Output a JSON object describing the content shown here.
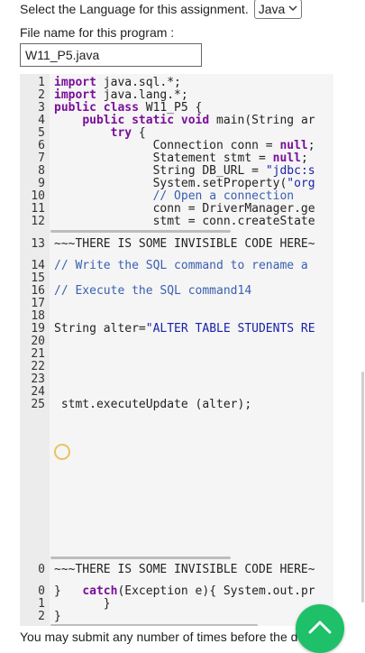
{
  "header": {
    "language_prompt": "Select the Language for this assignment.",
    "language_value": "Java"
  },
  "file": {
    "label": "File name for this program :",
    "value": "W11_P5.java"
  },
  "code_lines": [
    {
      "n": "1",
      "segs": [
        {
          "t": "import",
          "c": "kw"
        },
        {
          "t": " java.sql.*;",
          "c": ""
        }
      ]
    },
    {
      "n": "2",
      "segs": [
        {
          "t": "import",
          "c": "kw"
        },
        {
          "t": " java.lang.*;",
          "c": ""
        }
      ]
    },
    {
      "n": "3",
      "segs": [
        {
          "t": "public class",
          "c": "kw"
        },
        {
          "t": " W11_P5 {",
          "c": ""
        }
      ]
    },
    {
      "n": "4",
      "segs": [
        {
          "t": "    ",
          "c": ""
        },
        {
          "t": "public static void",
          "c": "kw"
        },
        {
          "t": " main(String ar",
          "c": ""
        }
      ]
    },
    {
      "n": "5",
      "segs": [
        {
          "t": "        ",
          "c": ""
        },
        {
          "t": "try",
          "c": "kw"
        },
        {
          "t": " {",
          "c": ""
        }
      ]
    },
    {
      "n": "6",
      "segs": [
        {
          "t": "              Connection conn = ",
          "c": ""
        },
        {
          "t": "null",
          "c": "kw"
        },
        {
          "t": ";",
          "c": ""
        }
      ]
    },
    {
      "n": "7",
      "segs": [
        {
          "t": "              Statement stmt = ",
          "c": ""
        },
        {
          "t": "null",
          "c": "kw"
        },
        {
          "t": ";",
          "c": ""
        }
      ]
    },
    {
      "n": "8",
      "segs": [
        {
          "t": "              String DB_URL = ",
          "c": ""
        },
        {
          "t": "\"jdbc:s",
          "c": "str"
        }
      ]
    },
    {
      "n": "9",
      "segs": [
        {
          "t": "              System.setProperty(",
          "c": ""
        },
        {
          "t": "\"org",
          "c": "str"
        }
      ]
    },
    {
      "n": "10",
      "segs": [
        {
          "t": "              ",
          "c": ""
        },
        {
          "t": "// Open a connection",
          "c": "com"
        }
      ]
    },
    {
      "n": "11",
      "segs": [
        {
          "t": "              conn = DriverManager.ge",
          "c": ""
        }
      ]
    },
    {
      "n": "12",
      "segs": [
        {
          "t": "              stmt = conn.createState",
          "c": ""
        }
      ]
    },
    {
      "n": "13",
      "segs": [
        {
          "t": "~~~THERE IS SOME INVISIBLE CODE HERE~",
          "c": ""
        }
      ]
    },
    {
      "n": "14",
      "segs": [
        {
          "t": "// Write the SQL command to rename a",
          "c": "com"
        }
      ]
    },
    {
      "n": "15",
      "segs": []
    },
    {
      "n": "16",
      "segs": [
        {
          "t": "// Execute the SQL command14",
          "c": "com"
        }
      ]
    },
    {
      "n": "17",
      "segs": []
    },
    {
      "n": "18",
      "segs": []
    },
    {
      "n": "19",
      "segs": [
        {
          "t": "String alter=",
          "c": ""
        },
        {
          "t": "\"ALTER TABLE STUDENTS RE",
          "c": "str"
        }
      ]
    },
    {
      "n": "20",
      "segs": []
    },
    {
      "n": "21",
      "segs": []
    },
    {
      "n": "22",
      "segs": []
    },
    {
      "n": "23",
      "segs": []
    },
    {
      "n": "24",
      "segs": []
    },
    {
      "n": "25",
      "segs": [
        {
          "t": " stmt.executeUpdate (alter);",
          "c": ""
        }
      ]
    },
    {
      "n": "0",
      "segs": [
        {
          "t": "~~~THERE IS SOME INVISIBLE CODE HERE~",
          "c": ""
        }
      ]
    },
    {
      "n": "0",
      "segs": [
        {
          "t": "}   ",
          "c": ""
        },
        {
          "t": "catch",
          "c": "kw"
        },
        {
          "t": "(Exception e){ System.out.pr",
          "c": ""
        }
      ]
    },
    {
      "n": "1",
      "segs": [
        {
          "t": "       }",
          "c": ""
        }
      ]
    },
    {
      "n": "2",
      "segs": [
        {
          "t": "}",
          "c": ""
        }
      ]
    }
  ],
  "footer": {
    "text": "You may submit any number of times before the d"
  },
  "colors": {
    "fab": "#1fc06a",
    "keyword": "#7a0f9a",
    "string": "#1a22a8"
  },
  "icons": {
    "fab": "chevron-up-icon",
    "select": "chevron-down-icon"
  }
}
